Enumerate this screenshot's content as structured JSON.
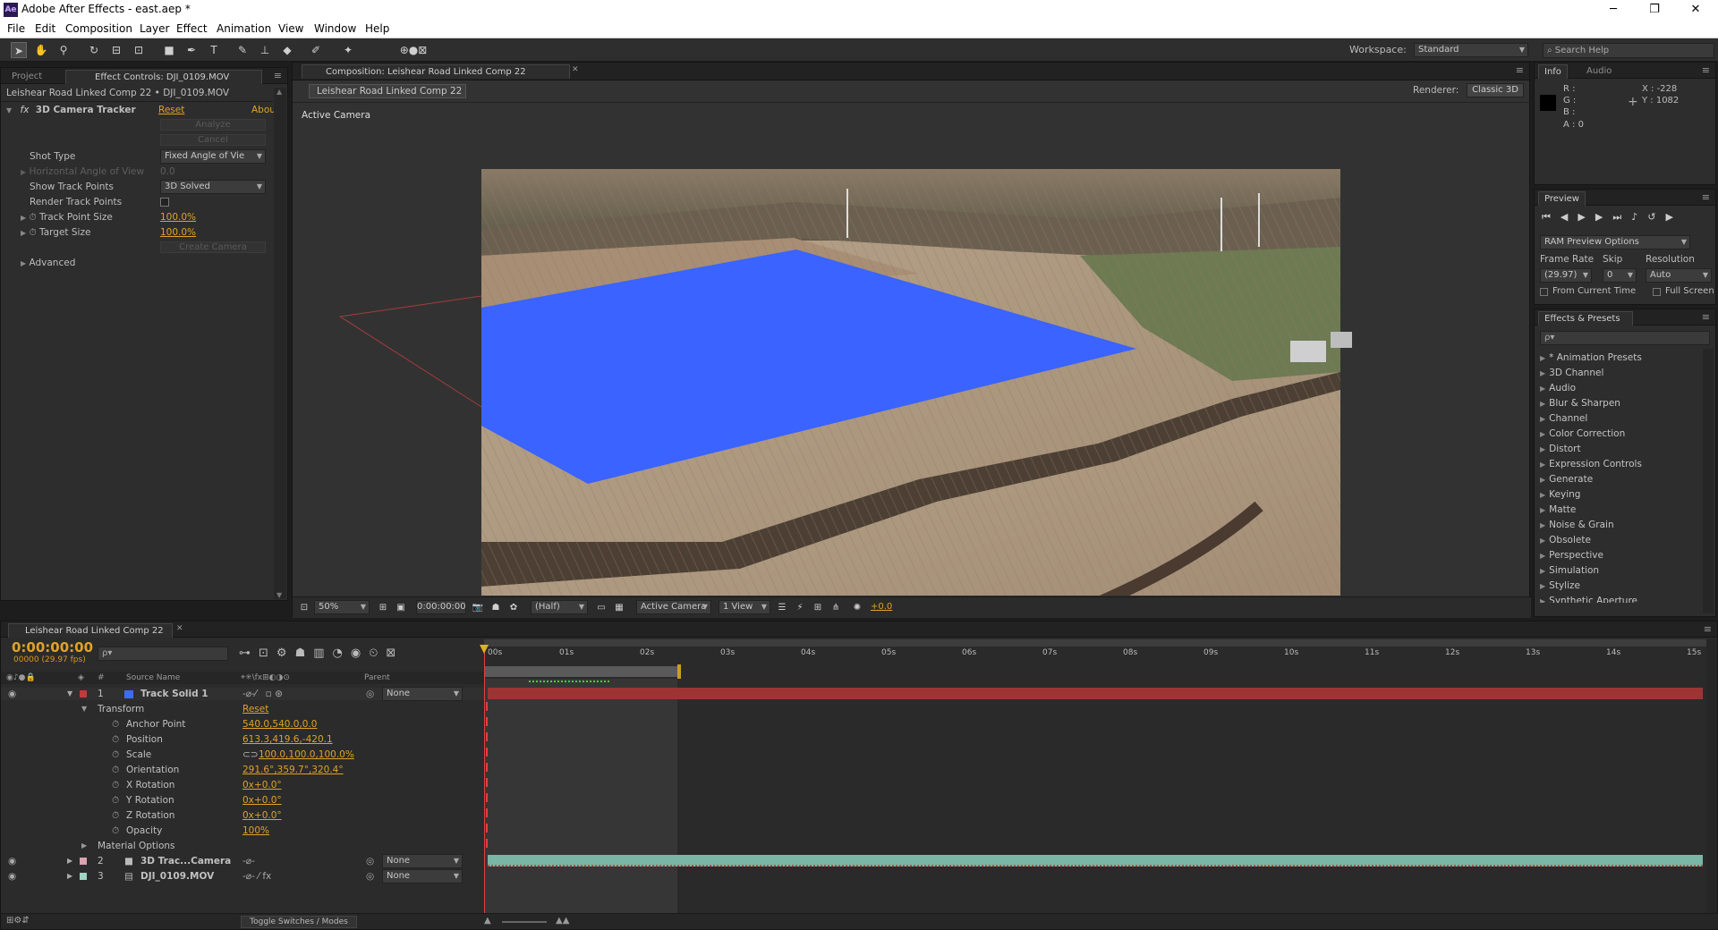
{
  "window": {
    "title": "Adobe After Effects - east.aep *",
    "app_icon": "Ae",
    "minimize": "─",
    "maximize": "❐",
    "close": "✕"
  },
  "menu": [
    "File",
    "Edit",
    "Composition",
    "Layer",
    "Effect",
    "Animation",
    "View",
    "Window",
    "Help"
  ],
  "toolbar": {
    "workspace_label": "Workspace:",
    "workspace_value": "Standard",
    "search_placeholder": "Search Help"
  },
  "left_panel": {
    "tabs": [
      "Project",
      "Effect Controls: DJI_0109.MOV"
    ],
    "breadcrumb": "Leishear Road Linked Comp 22 • DJI_0109.MOV",
    "effect": {
      "fx": "fx",
      "name": "3D Camera Tracker",
      "reset": "Reset",
      "about": "Abou"
    },
    "analyze": "Analyze",
    "cancel": "Cancel",
    "rows": [
      {
        "label": "Shot Type",
        "value": "Fixed Angle of Vie"
      },
      {
        "label": "Horizontal Angle of View",
        "value": "0.0"
      },
      {
        "label": "Show Track Points",
        "value": "3D Solved"
      },
      {
        "label": "Render Track Points",
        "value": ""
      },
      {
        "label": "Track Point Size",
        "value": "100.0%"
      },
      {
        "label": "Target Size",
        "value": "100.0%"
      }
    ],
    "create_camera": "Create Camera",
    "advanced": "Advanced"
  },
  "comp_panel": {
    "tab": "Composition: Leishear Road Linked Comp 22",
    "subtab": "Leishear Road Linked Comp 22",
    "renderer_label": "Renderer:",
    "renderer_value": "Classic 3D",
    "view_label": "Active Camera",
    "footer": {
      "zoom": "50%",
      "time": "0:00:00:00",
      "resolution": "(Half)",
      "camera": "Active Camera",
      "views": "1 View",
      "exposure": "+0.0"
    }
  },
  "info_panel": {
    "tabs": [
      "Info",
      "Audio"
    ],
    "r": "R :",
    "g": "G :",
    "b": "B :",
    "a": "A : 0",
    "x": "X : -228",
    "y": "Y : 1082"
  },
  "preview_panel": {
    "tab": "Preview",
    "ram_options": "RAM Preview Options",
    "frame_rate_label": "Frame Rate",
    "skip_label": "Skip",
    "resolution_label": "Resolution",
    "frame_rate": "(29.97)",
    "skip": "0",
    "resolution": "Auto",
    "from_current": "From Current Time",
    "full_screen": "Full Screen"
  },
  "effects_panel": {
    "tab": "Effects & Presets",
    "search_placeholder": "ρ▾",
    "items": [
      "* Animation Presets",
      "3D Channel",
      "Audio",
      "Blur & Sharpen",
      "Channel",
      "Color Correction",
      "Distort",
      "Expression Controls",
      "Generate",
      "Keying",
      "Matte",
      "Noise & Grain",
      "Obsolete",
      "Perspective",
      "Simulation",
      "Stylize",
      "Synthetic Aperture"
    ]
  },
  "timeline": {
    "tab": "Leishear Road Linked Comp 22",
    "timecode": "0:00:00:00",
    "fps": "00000 (29.97 fps)",
    "search_placeholder": "ρ▾",
    "col_source": "Source Name",
    "col_parent": "Parent",
    "col_num": "#",
    "ruler": [
      "00s",
      "01s",
      "02s",
      "03s",
      "04s",
      "05s",
      "06s",
      "07s",
      "08s",
      "09s",
      "10s",
      "11s",
      "12s",
      "13s",
      "14s",
      "15s"
    ],
    "layers": [
      {
        "num": "1",
        "name": "Track Solid 1",
        "color": "#c23a3a",
        "label_color": "#3d6cf0",
        "parent": "None"
      },
      {
        "num": "2",
        "name": "3D Trac...Camera",
        "color": "#d9a3b0",
        "parent": "None"
      },
      {
        "num": "3",
        "name": "DJI_0109.MOV",
        "color": "#9fd4c4",
        "parent": "None"
      }
    ],
    "transform": "Transform",
    "transform_reset": "Reset",
    "props": [
      {
        "name": "Anchor Point",
        "value": "540.0,540.0,0.0"
      },
      {
        "name": "Position",
        "value": "613.3,419.6,-420.1"
      },
      {
        "name": "Scale",
        "value": "100.0,100.0,100.0%"
      },
      {
        "name": "Orientation",
        "value": "291.6°,359.7°,320.4°"
      },
      {
        "name": "X Rotation",
        "value": "0x+0.0°"
      },
      {
        "name": "Y Rotation",
        "value": "0x+0.0°"
      },
      {
        "name": "Z Rotation",
        "value": "0x+0.0°"
      },
      {
        "name": "Opacity",
        "value": "100%"
      }
    ],
    "material_options": "Material Options",
    "toggle": "Toggle Switches / Modes"
  }
}
